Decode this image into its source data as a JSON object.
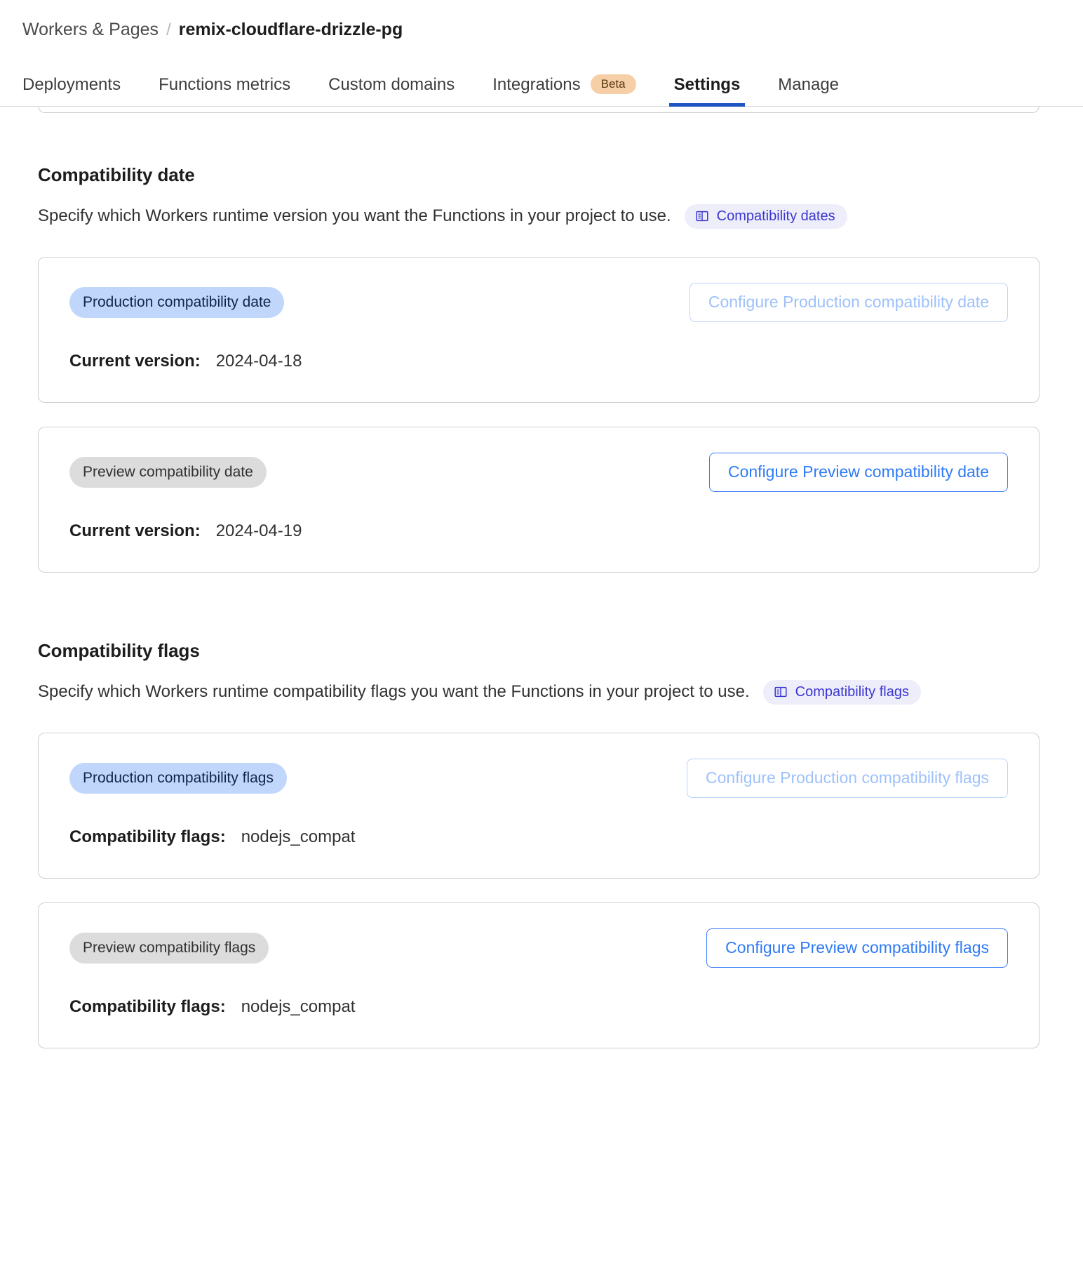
{
  "breadcrumb": {
    "parent": "Workers & Pages",
    "separator": "/",
    "current": "remix-cloudflare-drizzle-pg"
  },
  "tabs": [
    {
      "label": "Deployments",
      "active": false
    },
    {
      "label": "Functions metrics",
      "active": false
    },
    {
      "label": "Custom domains",
      "active": false
    },
    {
      "label": "Integrations",
      "active": false,
      "badge": "Beta"
    },
    {
      "label": "Settings",
      "active": true
    },
    {
      "label": "Manage",
      "active": false
    }
  ],
  "sections": [
    {
      "title": "Compatibility date",
      "description": "Specify which Workers runtime version you want the Functions in your project to use.",
      "doc_link": "Compatibility dates",
      "doc_icon": "book-icon",
      "cards": [
        {
          "env_label": "Production compatibility date",
          "env_style": "prod",
          "button_label": "Configure Production compatibility date",
          "button_disabled": true,
          "key": "Current version:",
          "value": "2024-04-18"
        },
        {
          "env_label": "Preview compatibility date",
          "env_style": "preview",
          "button_label": "Configure Preview compatibility date",
          "button_disabled": false,
          "key": "Current version:",
          "value": "2024-04-19"
        }
      ]
    },
    {
      "title": "Compatibility flags",
      "description": "Specify which Workers runtime compatibility flags you want the Functions in your project to use.",
      "doc_link": "Compatibility flags",
      "doc_icon": "book-icon",
      "cards": [
        {
          "env_label": "Production compatibility flags",
          "env_style": "prod",
          "button_label": "Configure Production compatibility flags",
          "button_disabled": true,
          "key": "Compatibility flags:",
          "value": "nodejs_compat"
        },
        {
          "env_label": "Preview compatibility flags",
          "env_style": "preview",
          "button_label": "Configure Preview compatibility flags",
          "button_disabled": false,
          "key": "Compatibility flags:",
          "value": "nodejs_compat"
        }
      ]
    }
  ],
  "colors": {
    "accent_blue": "#2f7bf6",
    "active_tab_underline": "#1f54c3",
    "doc_pill_bg": "#eeeefb",
    "doc_pill_text": "#3b36cf",
    "prod_pill_bg": "#c0d7fb",
    "preview_pill_bg": "#dcdcdc",
    "beta_badge_bg": "#f7cfa7"
  }
}
